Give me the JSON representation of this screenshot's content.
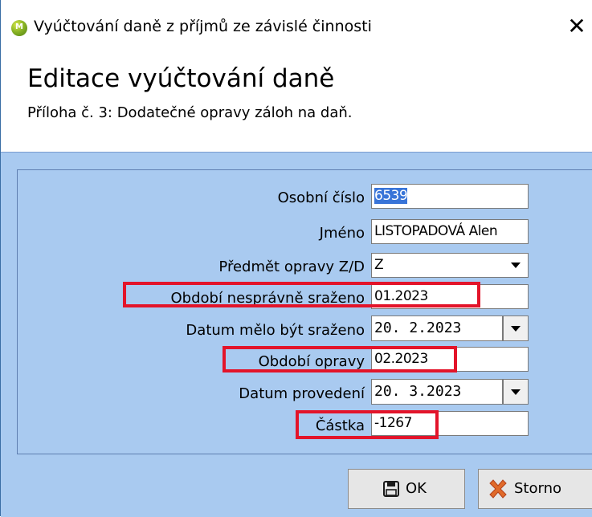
{
  "window": {
    "title": "Vyúčtování daně z příjmů ze závislé činnosti",
    "app_icon_letter": "M",
    "close_glyph": "✕"
  },
  "header": {
    "title": "Editace vyúčtování daně",
    "subtitle": "Příloha č. 3: Dodatečné opravy záloh na daň."
  },
  "form": {
    "osobni_cislo": {
      "label": "Osobní číslo",
      "value": "6539"
    },
    "jmeno": {
      "label": "Jméno",
      "value": "LISTOPADOVÁ Alen"
    },
    "predmet_opravy": {
      "label": "Předmět opravy Z/D",
      "value": "Z"
    },
    "obdobi_nespravne": {
      "label": "Období nesprávně sraženo",
      "value": "01.2023"
    },
    "datum_melo_byt": {
      "label": "Datum mělo být sraženo",
      "value": "20. 2.2023"
    },
    "obdobi_opravy": {
      "label": "Období opravy",
      "value": "02.2023"
    },
    "datum_provedeni": {
      "label": "Datum provedení",
      "value": "20. 3.2023"
    },
    "castka": {
      "label": "Částka",
      "value": "-1267"
    }
  },
  "buttons": {
    "ok": "OK",
    "storno": "Storno"
  },
  "colors": {
    "panel": "#a9caf0",
    "highlight": "#e3142a",
    "selection": "#3874d8"
  }
}
